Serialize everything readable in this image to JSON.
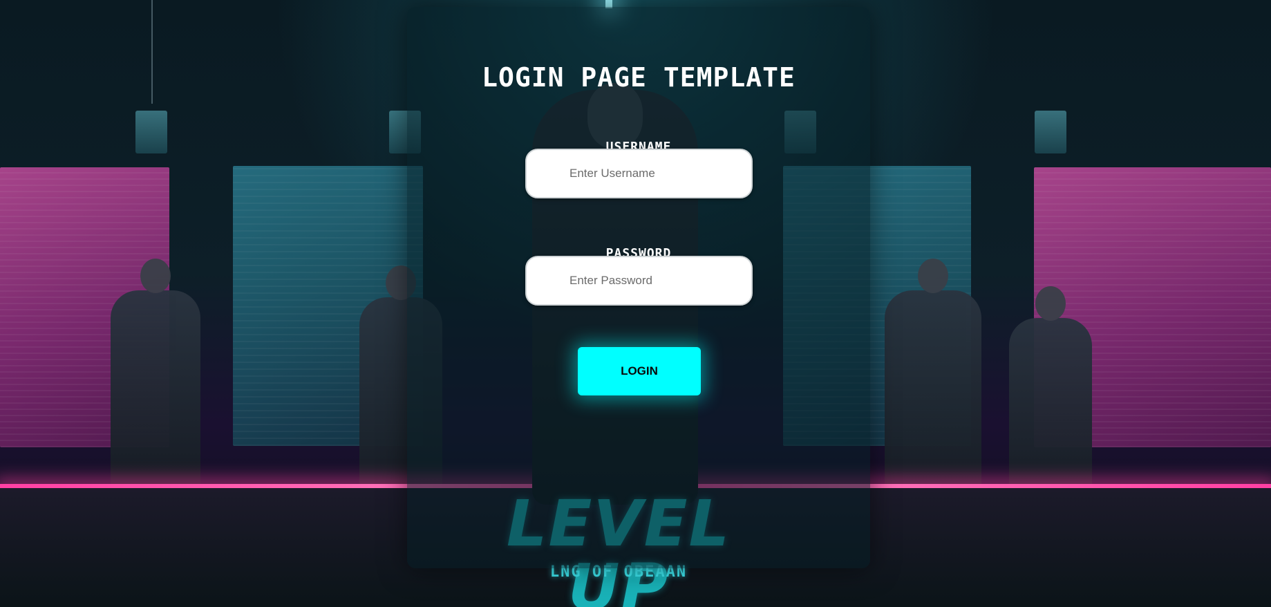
{
  "login": {
    "title": "LOGIN PAGE TEMPLATE",
    "username_label": "USERNAME",
    "username_placeholder": "Enter Username",
    "password_label": "PASSWORD",
    "password_placeholder": "Enter Password",
    "button_label": "LOGIN"
  },
  "background": {
    "logo_text": "LEVEL UP",
    "logo_subtext": "LNG OF OBEAAN"
  },
  "colors": {
    "accent": "#00ffff",
    "neon_pink": "#ff3fa4",
    "logo_teal": "#19b2b8",
    "card_bg": "#051e24"
  }
}
